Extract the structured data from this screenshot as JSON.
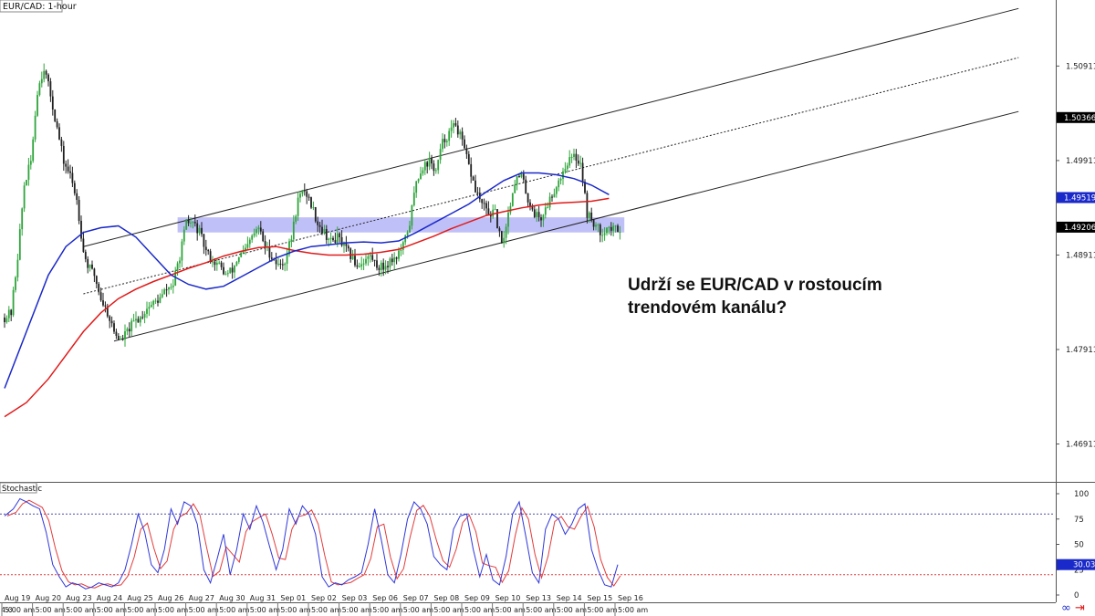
{
  "chart_data": {
    "type": "candlestick",
    "symbol_label": "EUR/CAD: 1-hour",
    "annotation_lines": [
      "Udrží se EUR/CAD v rostoucím",
      "trendovém kanálu?"
    ],
    "ylim": [
      1.4652,
      1.5161
    ],
    "y_ticks": [
      {
        "value": 1.50911,
        "label": "1.50911"
      },
      {
        "value": 1.49911,
        "label": "1.49911"
      },
      {
        "value": 1.48911,
        "label": "1.48911"
      },
      {
        "value": 1.47911,
        "label": "1.47911"
      },
      {
        "value": 1.46911,
        "label": "1.46911"
      }
    ],
    "price_markers": [
      {
        "value": 1.50366,
        "label": "1.50366",
        "bg": "#000000",
        "fg": "#ffffff"
      },
      {
        "value": 1.49519,
        "label": "1.49519",
        "bg": "#1a29c9",
        "fg": "#ffffff"
      },
      {
        "value": 1.49206,
        "label": "1.49206",
        "bg": "#000000",
        "fg": "#ffffff"
      }
    ],
    "x_labels": [
      {
        "bar": 0,
        "text": "Aug 19"
      },
      {
        "bar": 14,
        "text": "Aug 20"
      },
      {
        "bar": 28,
        "text": "Aug 23"
      },
      {
        "bar": 42,
        "text": "Aug 24"
      },
      {
        "bar": 56,
        "text": "Aug 25"
      },
      {
        "bar": 70,
        "text": "Aug 26"
      },
      {
        "bar": 84,
        "text": "Aug 27"
      },
      {
        "bar": 98,
        "text": "Aug 30"
      },
      {
        "bar": 112,
        "text": "Aug 31"
      },
      {
        "bar": 126,
        "text": "Sep 01"
      },
      {
        "bar": 140,
        "text": "Sep 02"
      },
      {
        "bar": 154,
        "text": "Sep 03"
      },
      {
        "bar": 168,
        "text": "Sep 06"
      },
      {
        "bar": 182,
        "text": "Sep 07"
      },
      {
        "bar": 196,
        "text": "Sep 08"
      },
      {
        "bar": 210,
        "text": "Sep 09"
      },
      {
        "bar": 224,
        "text": "Sep 10"
      },
      {
        "bar": 238,
        "text": "Sep 13"
      },
      {
        "bar": 252,
        "text": "Sep 14"
      },
      {
        "bar": 266,
        "text": "Sep 15"
      },
      {
        "bar": 280,
        "text": "Sep 16"
      }
    ],
    "x_sublabel": "5:00 am",
    "x_first_label": "4:0",
    "bars_total": 282,
    "price_path": [
      [
        0,
        1.4825
      ],
      [
        3,
        1.483
      ],
      [
        6,
        1.489
      ],
      [
        9,
        1.4965
      ],
      [
        12,
        1.499
      ],
      [
        15,
        1.5065
      ],
      [
        18,
        1.509
      ],
      [
        21,
        1.506
      ],
      [
        24,
        1.5025
      ],
      [
        27,
        1.499
      ],
      [
        30,
        1.4975
      ],
      [
        33,
        1.495
      ],
      [
        36,
        1.4895
      ],
      [
        38,
        1.488
      ],
      [
        41,
        1.487
      ],
      [
        44,
        1.4845
      ],
      [
        47,
        1.483
      ],
      [
        50,
        1.481
      ],
      [
        53,
        1.48
      ],
      [
        56,
        1.481
      ],
      [
        59,
        1.482
      ],
      [
        62,
        1.4825
      ],
      [
        65,
        1.4835
      ],
      [
        68,
        1.484
      ],
      [
        71,
        1.4845
      ],
      [
        74,
        1.4855
      ],
      [
        77,
        1.486
      ],
      [
        80,
        1.489
      ],
      [
        83,
        1.4925
      ],
      [
        86,
        1.4925
      ],
      [
        89,
        1.4915
      ],
      [
        92,
        1.4895
      ],
      [
        95,
        1.4885
      ],
      [
        98,
        1.488
      ],
      [
        101,
        1.487
      ],
      [
        104,
        1.4875
      ],
      [
        107,
        1.489
      ],
      [
        110,
        1.4895
      ],
      [
        113,
        1.491
      ],
      [
        116,
        1.492
      ],
      [
        119,
        1.49
      ],
      [
        122,
        1.489
      ],
      [
        125,
        1.488
      ],
      [
        128,
        1.4885
      ],
      [
        131,
        1.491
      ],
      [
        134,
        1.495
      ],
      [
        137,
        1.496
      ],
      [
        140,
        1.4945
      ],
      [
        143,
        1.4925
      ],
      [
        146,
        1.4915
      ],
      [
        149,
        1.4905
      ],
      [
        152,
        1.491
      ],
      [
        155,
        1.49
      ],
      [
        158,
        1.489
      ],
      [
        161,
        1.488
      ],
      [
        164,
        1.4885
      ],
      [
        167,
        1.489
      ],
      [
        170,
        1.488
      ],
      [
        173,
        1.4878
      ],
      [
        176,
        1.4885
      ],
      [
        179,
        1.489
      ],
      [
        182,
        1.49
      ],
      [
        185,
        1.4925
      ],
      [
        188,
        1.497
      ],
      [
        191,
        1.4985
      ],
      [
        194,
        1.499
      ],
      [
        197,
        1.498
      ],
      [
        200,
        1.501
      ],
      [
        203,
        1.502
      ],
      [
        206,
        1.503
      ],
      [
        209,
        1.501
      ],
      [
        212,
        1.4985
      ],
      [
        215,
        1.496
      ],
      [
        218,
        1.4945
      ],
      [
        221,
        1.4935
      ],
      [
        224,
        1.4935
      ],
      [
        227,
        1.49
      ],
      [
        230,
        1.4935
      ],
      [
        233,
        1.497
      ],
      [
        236,
        1.4975
      ],
      [
        239,
        1.495
      ],
      [
        242,
        1.4935
      ],
      [
        245,
        1.493
      ],
      [
        248,
        1.4945
      ],
      [
        251,
        1.496
      ],
      [
        254,
        1.4975
      ],
      [
        257,
        1.499
      ],
      [
        260,
        1.4995
      ],
      [
        263,
        1.499
      ],
      [
        266,
        1.4935
      ],
      [
        269,
        1.4925
      ],
      [
        272,
        1.4915
      ],
      [
        275,
        1.492
      ],
      [
        278,
        1.4918
      ],
      [
        281,
        1.492
      ]
    ],
    "ma_blue": [
      [
        0,
        1.475
      ],
      [
        10,
        1.481
      ],
      [
        20,
        1.487
      ],
      [
        28,
        1.49
      ],
      [
        36,
        1.4915
      ],
      [
        44,
        1.492
      ],
      [
        52,
        1.4922
      ],
      [
        60,
        1.491
      ],
      [
        68,
        1.489
      ],
      [
        76,
        1.487
      ],
      [
        84,
        1.486
      ],
      [
        92,
        1.4855
      ],
      [
        100,
        1.4858
      ],
      [
        108,
        1.4868
      ],
      [
        116,
        1.4878
      ],
      [
        124,
        1.4888
      ],
      [
        132,
        1.4895
      ],
      [
        140,
        1.49
      ],
      [
        148,
        1.4902
      ],
      [
        156,
        1.4904
      ],
      [
        164,
        1.4905
      ],
      [
        172,
        1.4904
      ],
      [
        180,
        1.4906
      ],
      [
        188,
        1.4915
      ],
      [
        196,
        1.4925
      ],
      [
        204,
        1.4935
      ],
      [
        212,
        1.4945
      ],
      [
        220,
        1.4958
      ],
      [
        228,
        1.497
      ],
      [
        236,
        1.4978
      ],
      [
        244,
        1.4978
      ],
      [
        252,
        1.4976
      ],
      [
        260,
        1.4972
      ],
      [
        268,
        1.4965
      ],
      [
        276,
        1.4955
      ]
    ],
    "ma_red": [
      [
        0,
        1.472
      ],
      [
        10,
        1.4735
      ],
      [
        20,
        1.476
      ],
      [
        28,
        1.4785
      ],
      [
        36,
        1.481
      ],
      [
        44,
        1.483
      ],
      [
        52,
        1.4845
      ],
      [
        60,
        1.4855
      ],
      [
        68,
        1.4863
      ],
      [
        76,
        1.487
      ],
      [
        84,
        1.4877
      ],
      [
        92,
        1.4883
      ],
      [
        100,
        1.489
      ],
      [
        108,
        1.4895
      ],
      [
        116,
        1.4899
      ],
      [
        124,
        1.49
      ],
      [
        132,
        1.4896
      ],
      [
        140,
        1.4893
      ],
      [
        148,
        1.4891
      ],
      [
        156,
        1.4891
      ],
      [
        164,
        1.4892
      ],
      [
        172,
        1.4894
      ],
      [
        180,
        1.4897
      ],
      [
        188,
        1.4904
      ],
      [
        196,
        1.4911
      ],
      [
        204,
        1.4919
      ],
      [
        212,
        1.4926
      ],
      [
        220,
        1.4933
      ],
      [
        228,
        1.4937
      ],
      [
        236,
        1.4941
      ],
      [
        244,
        1.4944
      ],
      [
        252,
        1.4946
      ],
      [
        260,
        1.4947
      ],
      [
        268,
        1.4948
      ],
      [
        276,
        1.4951
      ]
    ],
    "channel": {
      "upper": [
        [
          36,
          1.49
        ],
        [
          463,
          1.5152
        ]
      ],
      "middle": [
        [
          36,
          1.485
        ],
        [
          463,
          1.51
        ]
      ],
      "lower": [
        [
          50,
          1.48
        ],
        [
          463,
          1.5043
        ]
      ],
      "color": "#222222"
    },
    "zone": {
      "bar_start": 79,
      "bar_end": 283,
      "price_low": 1.4915,
      "price_high": 1.4931,
      "fill": "#8d8df2"
    },
    "stochastic": {
      "label": "Stochastic",
      "ylim": [
        0,
        100
      ],
      "y_ticks": [
        100,
        75,
        50,
        25,
        0
      ],
      "upper_level": 80,
      "lower_level": 20,
      "current_label": "30.03",
      "k_path": [
        [
          0,
          78
        ],
        [
          4,
          85
        ],
        [
          7,
          95
        ],
        [
          10,
          92
        ],
        [
          13,
          88
        ],
        [
          16,
          85
        ],
        [
          19,
          62
        ],
        [
          22,
          30
        ],
        [
          25,
          18
        ],
        [
          28,
          8
        ],
        [
          31,
          12
        ],
        [
          34,
          10
        ],
        [
          37,
          6
        ],
        [
          40,
          8
        ],
        [
          43,
          12
        ],
        [
          46,
          10
        ],
        [
          49,
          8
        ],
        [
          52,
          12
        ],
        [
          55,
          25
        ],
        [
          58,
          50
        ],
        [
          61,
          80
        ],
        [
          64,
          62
        ],
        [
          67,
          30
        ],
        [
          70,
          22
        ],
        [
          73,
          45
        ],
        [
          76,
          85
        ],
        [
          79,
          70
        ],
        [
          82,
          92
        ],
        [
          85,
          88
        ],
        [
          88,
          70
        ],
        [
          91,
          25
        ],
        [
          94,
          12
        ],
        [
          97,
          35
        ],
        [
          100,
          60
        ],
        [
          103,
          20
        ],
        [
          106,
          45
        ],
        [
          109,
          80
        ],
        [
          112,
          65
        ],
        [
          115,
          88
        ],
        [
          118,
          72
        ],
        [
          121,
          48
        ],
        [
          124,
          25
        ],
        [
          127,
          45
        ],
        [
          130,
          85
        ],
        [
          133,
          70
        ],
        [
          136,
          88
        ],
        [
          139,
          80
        ],
        [
          142,
          60
        ],
        [
          145,
          18
        ],
        [
          148,
          8
        ],
        [
          151,
          12
        ],
        [
          154,
          10
        ],
        [
          157,
          15
        ],
        [
          160,
          18
        ],
        [
          163,
          22
        ],
        [
          166,
          50
        ],
        [
          169,
          85
        ],
        [
          172,
          55
        ],
        [
          175,
          20
        ],
        [
          178,
          12
        ],
        [
          181,
          40
        ],
        [
          184,
          75
        ],
        [
          187,
          92
        ],
        [
          190,
          85
        ],
        [
          193,
          70
        ],
        [
          196,
          38
        ],
        [
          199,
          30
        ],
        [
          202,
          25
        ],
        [
          205,
          65
        ],
        [
          208,
          78
        ],
        [
          211,
          80
        ],
        [
          214,
          45
        ],
        [
          217,
          18
        ],
        [
          220,
          40
        ],
        [
          223,
          15
        ],
        [
          226,
          10
        ],
        [
          229,
          38
        ],
        [
          232,
          80
        ],
        [
          235,
          92
        ],
        [
          238,
          58
        ],
        [
          241,
          22
        ],
        [
          244,
          12
        ],
        [
          247,
          65
        ],
        [
          250,
          80
        ],
        [
          253,
          75
        ],
        [
          256,
          60
        ],
        [
          259,
          70
        ],
        [
          262,
          85
        ],
        [
          265,
          90
        ],
        [
          268,
          45
        ],
        [
          271,
          25
        ],
        [
          274,
          10
        ],
        [
          277,
          8
        ],
        [
          280,
          30
        ]
      ],
      "k_color": "#2f37d8",
      "d_color": "#e23b3b"
    },
    "colors": {
      "up": "#2ea43a",
      "down": "#1f1f1f",
      "ma_blue": "#1a29c9",
      "ma_red": "#e11a1a",
      "stoch_upper": "#4c4ca8",
      "stoch_lower": "#e23b3b"
    }
  }
}
